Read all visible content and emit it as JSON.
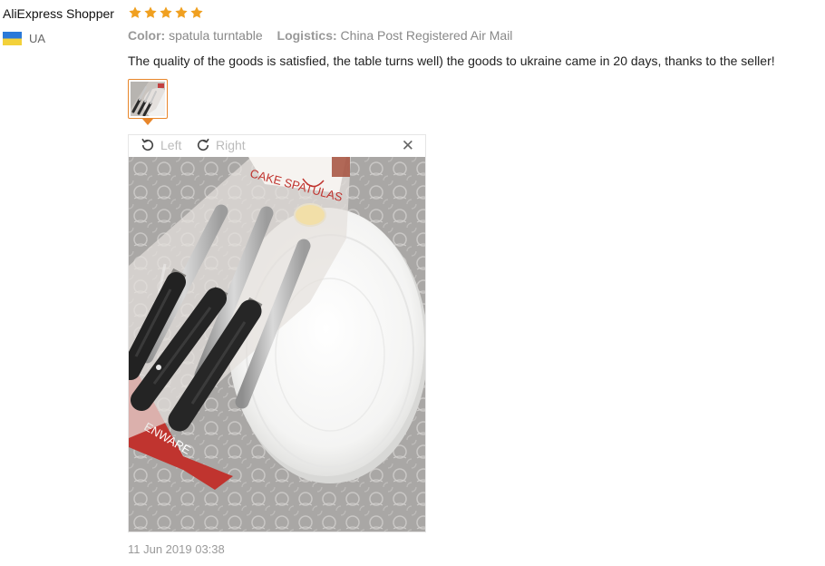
{
  "review": {
    "user_name": "AliExpress Shopper",
    "rating": 5,
    "country_code": "UA",
    "flag_colors": [
      "#2a79d8",
      "#f3d13a"
    ],
    "star_color": "#f0a020",
    "color_label": "Color:",
    "color_value": "spatula turntable",
    "logistics_label": "Logistics:",
    "logistics_value": "China Post Registered Air Mail",
    "text": "The quality of the goods is satisfied, the table turns well) the goods to ukraine came in 20 days, thanks to the seller!",
    "timestamp": "11 Jun 2019 03:38"
  },
  "viewer": {
    "rotate_left_label": "Left",
    "rotate_right_label": "Right",
    "close_symbol": "✕",
    "rotate_left_icon": "rotate-left-icon",
    "rotate_right_icon": "rotate-right-icon",
    "close_icon": "close-icon",
    "photo_text": {
      "package_title": "CAKE SPATULAS",
      "package_side": "ENWARE"
    }
  }
}
